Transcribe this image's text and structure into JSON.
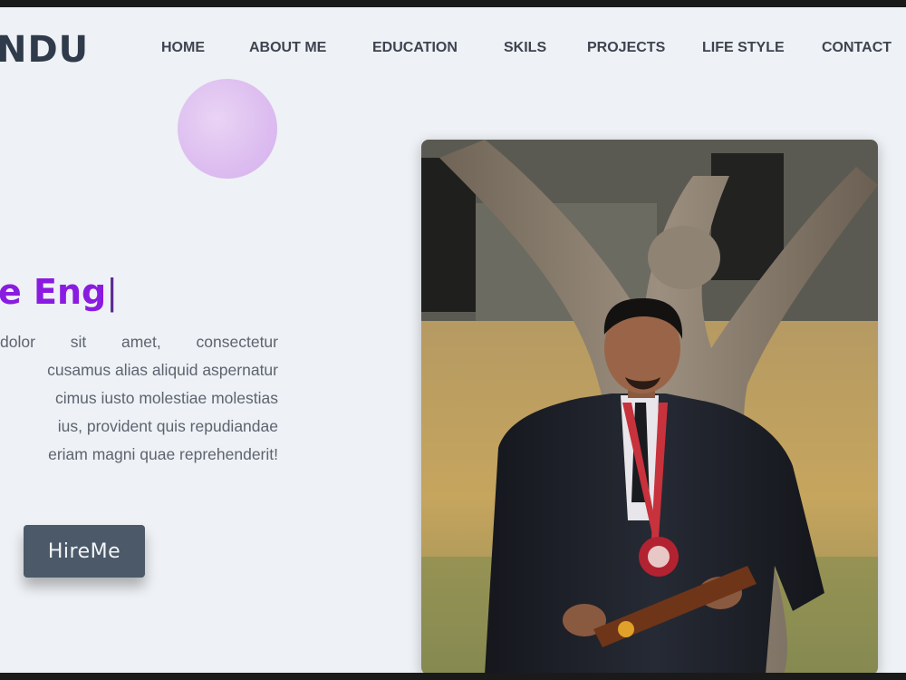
{
  "brand": {
    "logo_text": "NDU"
  },
  "nav": {
    "items": [
      {
        "label": "HOME"
      },
      {
        "label": "ABOUT ME"
      },
      {
        "label": "EDUCATION"
      },
      {
        "label": "SKILS"
      },
      {
        "label": "PROJECTS"
      },
      {
        "label": "LIFE STYLE"
      },
      {
        "label": "CONTACT"
      }
    ]
  },
  "hero": {
    "headline": "e Eng",
    "cursor": "|",
    "paragraph_lines": [
      "dolor sit amet, consectetur",
      "cusamus alias aliquid aspernatur",
      "cimus iusto molestiae molestias",
      "ius, provident quis repudiandae",
      "eriam magni quae reprehenderit!"
    ],
    "cta_label": "HireMe"
  },
  "colors": {
    "page_bg": "#eef1f5",
    "headline": "#8a1be0",
    "nav_text": "#3d4450",
    "button_bg": "#4b5968",
    "bubble": "#ddbdf0"
  },
  "photo": {
    "icon": "profile-photo-graduate"
  }
}
